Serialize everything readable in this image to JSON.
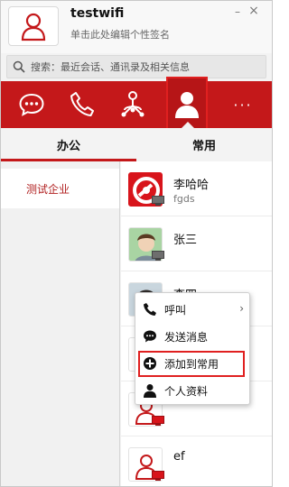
{
  "header": {
    "username": "testwifi",
    "signature": "单击此处编辑个性签名",
    "minimize": "–",
    "close": "×"
  },
  "search": {
    "placeholder": "搜索：最近会话、通讯录及相关信息",
    "icon": "search-icon"
  },
  "toolbar": {
    "items": [
      "chat-icon",
      "phone-icon",
      "organization-icon",
      "contacts-icon",
      "more-icon"
    ],
    "more_label": "···",
    "accent": "#c4181a"
  },
  "tabs": {
    "office": "办公",
    "common": "常用"
  },
  "org": {
    "items": [
      {
        "label": "测试企业"
      }
    ]
  },
  "contacts": [
    {
      "name": "李哈哈",
      "sub": "fgds",
      "avatar": "app-logo-avatar"
    },
    {
      "name": "张三",
      "sub": "",
      "avatar": "photo-avatar"
    },
    {
      "name": "李四",
      "sub": "",
      "avatar": "photo-avatar"
    },
    {
      "name": "",
      "sub": "",
      "avatar": "default-avatar"
    },
    {
      "name": "",
      "sub": "",
      "avatar": "default-avatar"
    },
    {
      "name": "ef",
      "sub": "",
      "avatar": "default-avatar"
    }
  ],
  "context_menu": {
    "call": "呼叫",
    "send_message": "发送消息",
    "add_to_common": "添加到常用",
    "profile": "个人资料",
    "submenu_arrow": "›"
  }
}
